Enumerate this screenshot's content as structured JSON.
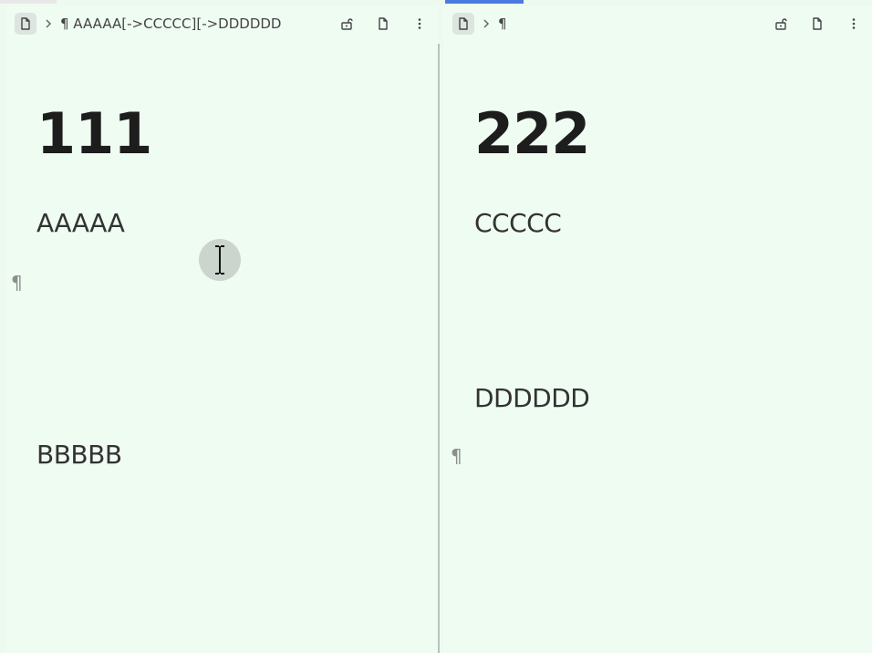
{
  "left_pane": {
    "breadcrumb": "¶ AAAAA[->CCCCC][->DDDDDD",
    "heading": "111",
    "paragraphs": [
      "AAAAA",
      "BBBBB"
    ],
    "pilcrow": "¶"
  },
  "right_pane": {
    "breadcrumb": "¶",
    "heading": "222",
    "paragraphs": [
      "CCCCC",
      "DDDDDD"
    ],
    "pilcrow": "¶"
  },
  "colors": {
    "background": "#effcf2",
    "active_tab_indicator": "#4a7be0"
  },
  "icons": [
    "document-icon",
    "chevron-right-icon",
    "unlock-icon",
    "document-icon",
    "more-vertical-icon"
  ]
}
